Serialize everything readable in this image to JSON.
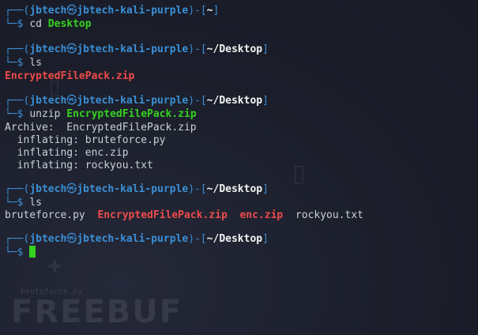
{
  "terminal": {
    "user": "jbtech",
    "skull": "㉿",
    "host": "jbtech-kali-purple",
    "blocks": [
      {
        "path": "~",
        "cmd": "cd",
        "arg": "Desktop"
      },
      {
        "path": "~/Desktop",
        "cmd": "ls",
        "output": [
          "EncryptedFilePack.zip"
        ]
      },
      {
        "path": "~/Desktop",
        "cmd": "unzip",
        "arg": "EncryptedFilePack.zip",
        "output": [
          "Archive:  EncryptedFilePack.zip",
          "  inflating: bruteforce.py",
          "  inflating: enc.zip",
          "  inflating: rockyou.txt"
        ]
      },
      {
        "path": "~/Desktop",
        "cmd": "ls",
        "listing": [
          {
            "name": "bruteforce.py",
            "style": "plain"
          },
          {
            "name": "EncryptedFilePack.zip",
            "style": "red"
          },
          {
            "name": "enc.zip",
            "style": "red"
          },
          {
            "name": "rockyou.txt",
            "style": "plain"
          }
        ]
      },
      {
        "path": "~/Desktop",
        "cmd": ""
      }
    ]
  },
  "watermark": {
    "caption": "bruteforce.py",
    "brand": "FREEBUF"
  },
  "colors": {
    "background": "#1b1e2a",
    "prompt_frame": "#3a8fd6",
    "command_arg": "#35d11f",
    "archive_file": "#ee4b4b",
    "text": "#c9d1d9"
  }
}
